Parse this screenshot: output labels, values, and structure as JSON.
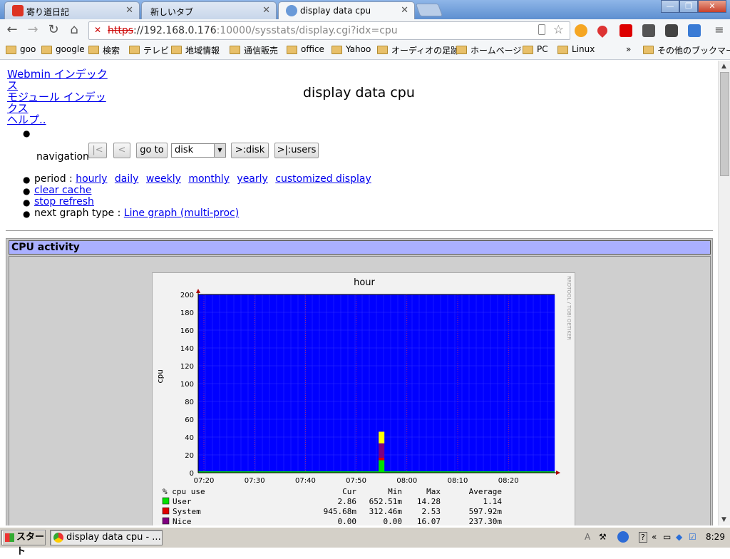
{
  "browser": {
    "tabs": [
      {
        "label": "寄り道日記",
        "active": false
      },
      {
        "label": "新しいタブ",
        "active": false
      },
      {
        "label": "display data cpu",
        "active": true
      }
    ],
    "url": {
      "scheme": "https",
      "rest": "://192.168.0.176",
      "path": ":10000/sysstats/display.cgi?idx=cpu"
    },
    "bookmarks": [
      "goo",
      "google",
      "検索",
      "テレビ",
      "地域情報",
      "通信販売",
      "office",
      "Yahoo",
      "オーディオの足跡",
      "ホームページ",
      "PC",
      "Linux"
    ],
    "bookmarks_more": "»",
    "other_bookmarks": "その他のブックマーク"
  },
  "page": {
    "links": {
      "webmin": "Webmin インデックス",
      "module": "モジュール インデックス",
      "help": "ヘルプ.."
    },
    "title": "display data cpu",
    "navigation": {
      "label": "navigation",
      "first": "|<",
      "prev": "<",
      "goto": "go to",
      "select_value": "disk",
      "next_disk": ">:disk",
      "next_users": ">|:users"
    },
    "period_label": "period :",
    "periods": [
      "hourly",
      "daily",
      "weekly",
      "monthly",
      "yearly",
      "customized display"
    ],
    "clear_cache": "clear cache",
    "stop_refresh": "stop refresh",
    "next_graph_label": "next graph type :",
    "next_graph_link": "Line graph (multi-proc)"
  },
  "panel": {
    "title": "CPU activity"
  },
  "chart_data": {
    "type": "area",
    "title": "hour",
    "ylabel": "cpu",
    "side_text": "RRDTOOL / TOBI OETIKER",
    "ylim": [
      0,
      200
    ],
    "yticks": [
      0,
      20,
      40,
      60,
      80,
      100,
      120,
      140,
      160,
      180,
      200
    ],
    "xticks": [
      "07:20",
      "07:30",
      "07:40",
      "07:50",
      "08:00",
      "08:10",
      "08:20"
    ],
    "background_color": "#0000ff",
    "series": [
      {
        "name": "User",
        "color": "#00e000",
        "values_note": "spike near 07:55",
        "cur": "2.86",
        "min": "652.51m",
        "max": "14.28",
        "avg": "1.14"
      },
      {
        "name": "System",
        "color": "#e00000",
        "cur": "945.68m",
        "min": "312.46m",
        "max": "2.53",
        "avg": "597.92m"
      },
      {
        "name": "Nice",
        "color": "#800080",
        "cur": "0.00",
        "min": "0.00",
        "max": "16.07",
        "avg": "237.30m"
      }
    ],
    "spike": {
      "x": "07:55",
      "segments": [
        {
          "series": "User",
          "from": 0,
          "to": 14
        },
        {
          "series": "System",
          "from": 14,
          "to": 17
        },
        {
          "series": "Nice",
          "from": 17,
          "to": 33
        },
        {
          "series": "yellow",
          "color": "#ffff00",
          "from": 33,
          "to": 46
        }
      ]
    },
    "legend_header": {
      "label": "% cpu use",
      "cur": "Cur",
      "min": "Min",
      "max": "Max",
      "avg": "Average"
    }
  },
  "taskbar": {
    "start": "スタート",
    "item": "display data cpu - ...",
    "clock": "8:29"
  }
}
